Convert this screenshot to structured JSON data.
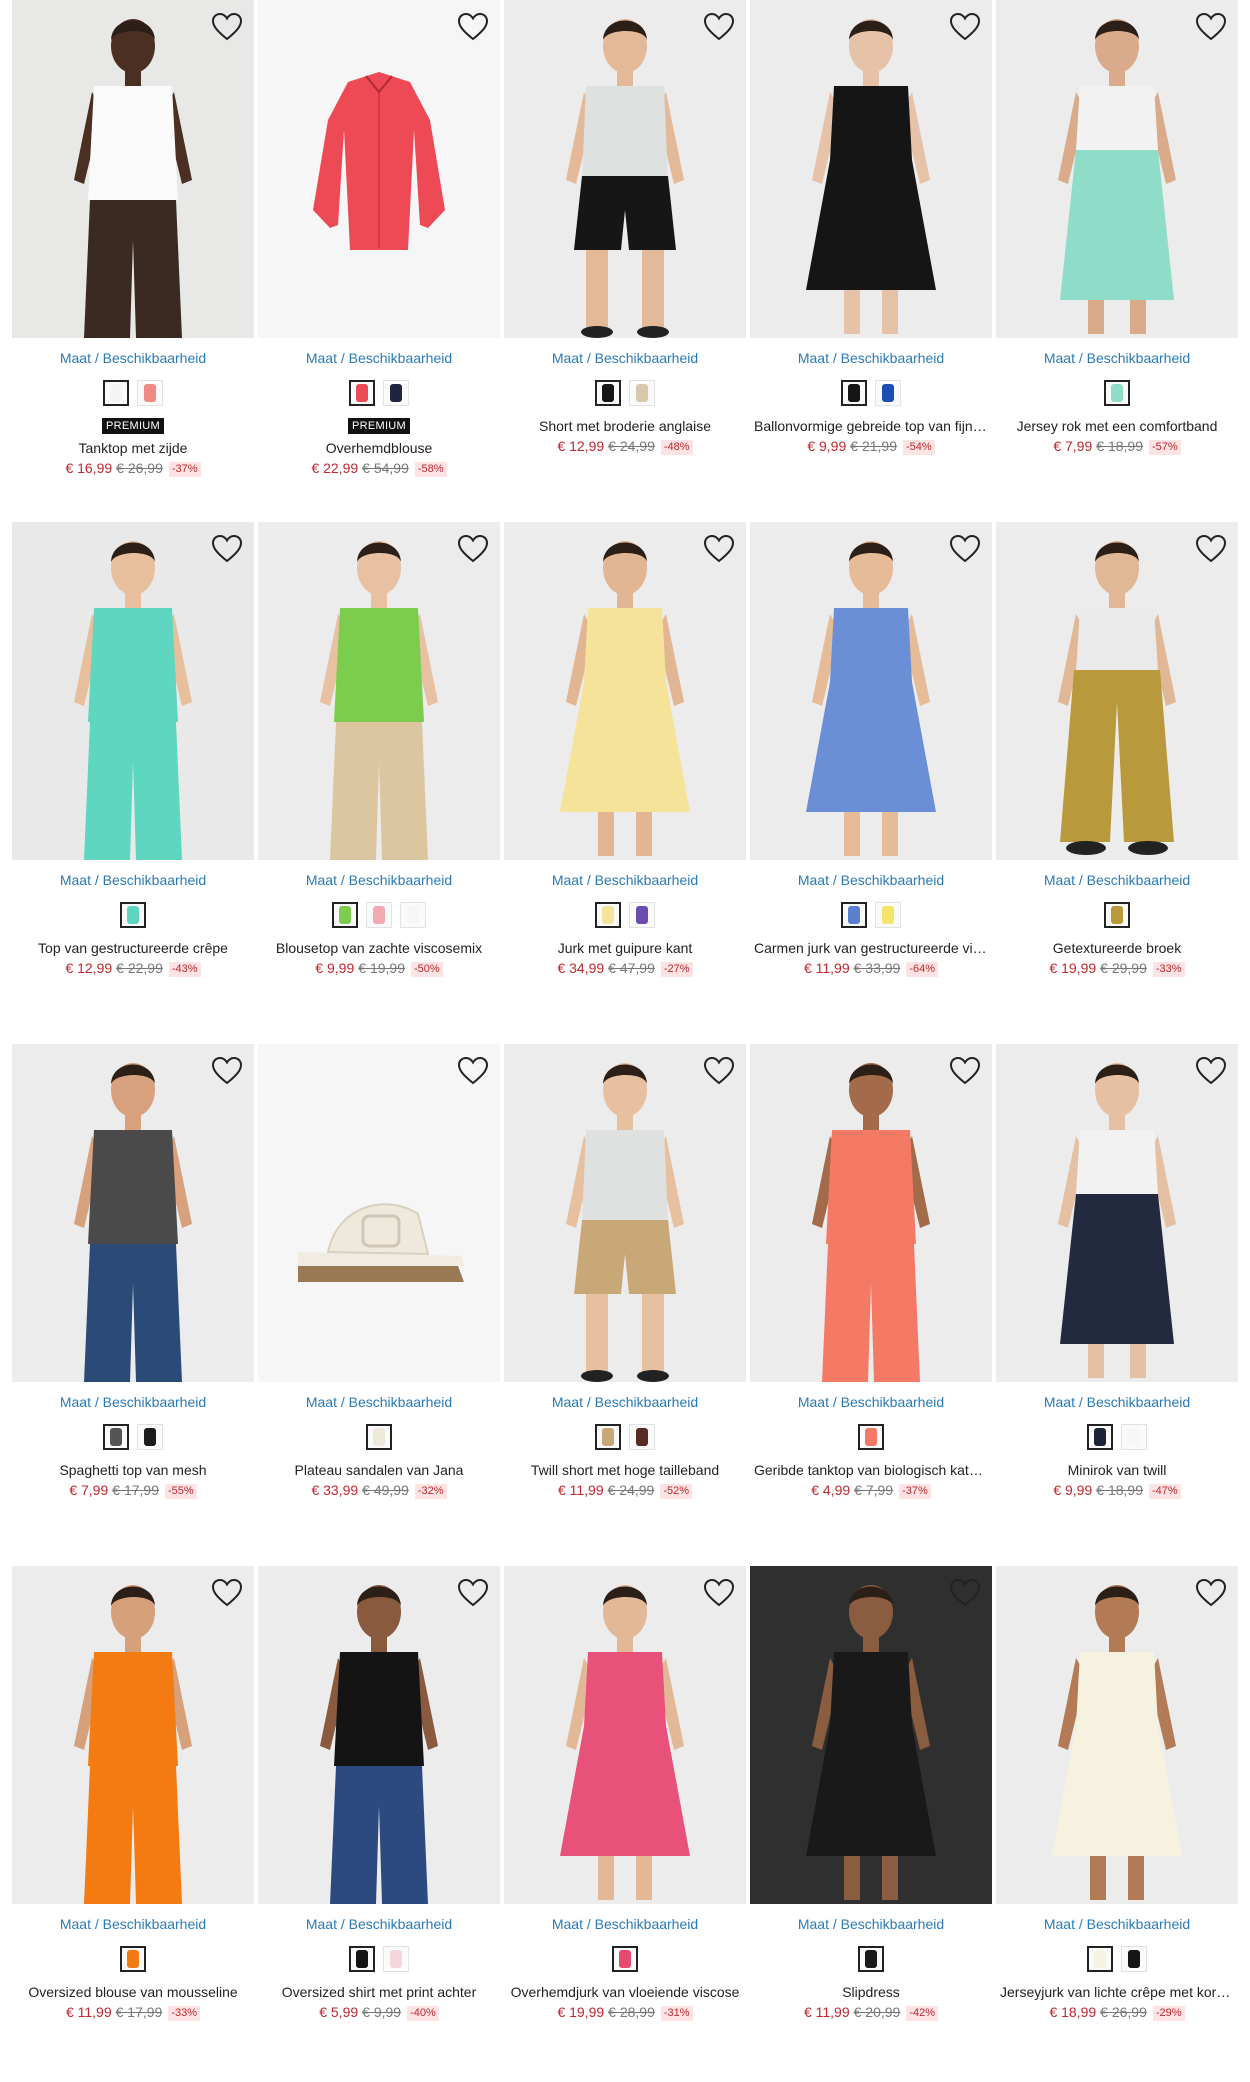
{
  "colors": {
    "link": "#2a7ab8",
    "price": "#c0282d",
    "discount_bg": "#fde3e3",
    "badge_bg": "#111111"
  },
  "products": [
    {
      "name": "Tanktop met zijde",
      "price": "€ 16,99",
      "old_price": "€ 26,99",
      "discount": "-37%",
      "badge": "PREMIUM",
      "size_link": "Maat",
      "avail_link": "Beschikbaarheid",
      "swatches": [
        "#f4f4f2",
        "#f08a86"
      ],
      "selected_swatch": 0,
      "bg": "#e8e8e6",
      "garment": "#fafafa",
      "skin": "#4a2f22",
      "shape": "top",
      "bottom": "#3a2a22"
    },
    {
      "name": "Overhemdblouse",
      "price": "€ 22,99",
      "old_price": "€ 54,99",
      "discount": "-58%",
      "badge": "PREMIUM",
      "size_link": "Maat",
      "avail_link": "Beschikbaarheid",
      "swatches": [
        "#ee4a55",
        "#1d2540"
      ],
      "selected_swatch": 0,
      "bg": "#f6f6f6",
      "garment": "#ee4a55",
      "skin": "",
      "shape": "flat",
      "bottom": ""
    },
    {
      "name": "Short met broderie anglaise",
      "price": "€ 12,99",
      "old_price": "€ 24,99",
      "discount": "-48%",
      "badge": "",
      "size_link": "Maat",
      "avail_link": "Beschikbaarheid",
      "swatches": [
        "#161616",
        "#d8c9ad"
      ],
      "selected_swatch": 0,
      "bg": "#ececec",
      "garment": "#161616",
      "skin": "#e3b998",
      "shape": "shorts",
      "bottom": "#161616"
    },
    {
      "name": "Ballonvormige gebreide top van fijn tricot",
      "price": "€ 9,99",
      "old_price": "€ 21,99",
      "discount": "-54%",
      "badge": "",
      "size_link": "Maat",
      "avail_link": "Beschikbaarheid",
      "swatches": [
        "#151515",
        "#1c4fb5"
      ],
      "selected_swatch": 0,
      "bg": "#ececec",
      "garment": "#151515",
      "skin": "#e6c3a8",
      "shape": "dress",
      "bottom": "#151515"
    },
    {
      "name": "Jersey rok met een comfortband",
      "price": "€ 7,99",
      "old_price": "€ 18,99",
      "discount": "-57%",
      "badge": "",
      "size_link": "Maat",
      "avail_link": "Beschikbaarheid",
      "swatches": [
        "#8fdcc8"
      ],
      "selected_swatch": 0,
      "bg": "#ececec",
      "garment": "#8fdcc8",
      "skin": "#d9ab8b",
      "shape": "skirt",
      "bottom": "#8fdcc8"
    },
    {
      "name": "Top van gestructureerde crêpe",
      "price": "€ 12,99",
      "old_price": "€ 22,99",
      "discount": "-43%",
      "badge": "",
      "size_link": "Maat",
      "avail_link": "Beschikbaarheid",
      "swatches": [
        "#5fd6c0"
      ],
      "selected_swatch": 0,
      "bg": "#e9e9e9",
      "garment": "#5fd6c0",
      "skin": "#e8bf9c",
      "shape": "top",
      "bottom": "#5fd6c0"
    },
    {
      "name": "Blousetop van zachte viscosemix",
      "price": "€ 9,99",
      "old_price": "€ 19,99",
      "discount": "-50%",
      "badge": "",
      "size_link": "Maat",
      "avail_link": "Beschikbaarheid",
      "swatches": [
        "#7ccd4e",
        "#f2a9b0",
        "#f6f6f6"
      ],
      "selected_swatch": 0,
      "bg": "#ececec",
      "garment": "#7ccd4e",
      "skin": "#e7c1a2",
      "shape": "top",
      "bottom": "#dcc6a0"
    },
    {
      "name": "Jurk met guipure kant",
      "price": "€ 34,99",
      "old_price": "€ 47,99",
      "discount": "-27%",
      "badge": "",
      "size_link": "Maat",
      "avail_link": "Beschikbaarheid",
      "swatches": [
        "#f5e39a",
        "#6a4bb0"
      ],
      "selected_swatch": 0,
      "bg": "#ececec",
      "garment": "#f5e39a",
      "skin": "#e2b593",
      "shape": "dress",
      "bottom": "#f5e39a"
    },
    {
      "name": "Carmen jurk van gestructureerde viscose",
      "price": "€ 11,99",
      "old_price": "€ 33,99",
      "discount": "-64%",
      "badge": "",
      "size_link": "Maat",
      "avail_link": "Beschikbaarheid",
      "swatches": [
        "#5a7fcf",
        "#f3e56a"
      ],
      "selected_swatch": 0,
      "bg": "#ececec",
      "garment": "#6b8fd6",
      "skin": "#e5bb98",
      "shape": "dress",
      "bottom": "#6b8fd6"
    },
    {
      "name": "Getextureerde broek",
      "price": "€ 19,99",
      "old_price": "€ 29,99",
      "discount": "-33%",
      "badge": "",
      "size_link": "Maat",
      "avail_link": "Beschikbaarheid",
      "swatches": [
        "#b89a3c"
      ],
      "selected_swatch": 0,
      "bg": "#ececec",
      "garment": "#b89a3c",
      "skin": "#e0b896",
      "shape": "pants",
      "bottom": "#b89a3c"
    },
    {
      "name": "Spaghetti top van mesh",
      "price": "€ 7,99",
      "old_price": "€ 17,99",
      "discount": "-55%",
      "badge": "",
      "size_link": "Maat",
      "avail_link": "Beschikbaarheid",
      "swatches": [
        "#555555",
        "#1a1a1a"
      ],
      "selected_swatch": 0,
      "bg": "#ececec",
      "garment": "#4a4a4a",
      "skin": "#d6a17c",
      "shape": "top",
      "bottom": "#2c4a78"
    },
    {
      "name": "Plateau sandalen van Jana",
      "price": "€ 33,99",
      "old_price": "€ 49,99",
      "discount": "-32%",
      "badge": "",
      "size_link": "Maat",
      "avail_link": "Beschikbaarheid",
      "swatches": [
        "#efe9dc"
      ],
      "selected_swatch": 0,
      "bg": "#f6f6f6",
      "garment": "#efe9dc",
      "skin": "",
      "shape": "shoe",
      "bottom": ""
    },
    {
      "name": "Twill short met hoge tailleband",
      "price": "€ 11,99",
      "old_price": "€ 24,99",
      "discount": "-52%",
      "badge": "",
      "size_link": "Maat",
      "avail_link": "Beschikbaarheid",
      "swatches": [
        "#c9a878",
        "#5a2a24"
      ],
      "selected_swatch": 0,
      "bg": "#ececec",
      "garment": "#c9a878",
      "skin": "#e7c0a0",
      "shape": "shorts",
      "bottom": "#c9a878"
    },
    {
      "name": "Geribde tanktop van biologisch katoen",
      "price": "€ 4,99",
      "old_price": "€ 7,99",
      "discount": "-37%",
      "badge": "",
      "size_link": "Maat",
      "avail_link": "Beschikbaarheid",
      "swatches": [
        "#f57a65"
      ],
      "selected_swatch": 0,
      "bg": "#ececec",
      "garment": "#f57a65",
      "skin": "#a46b4a",
      "shape": "top",
      "bottom": "#f57a65"
    },
    {
      "name": "Minirok van twill",
      "price": "€ 9,99",
      "old_price": "€ 18,99",
      "discount": "-47%",
      "badge": "",
      "size_link": "Maat",
      "avail_link": "Beschikbaarheid",
      "swatches": [
        "#1e2438",
        "#f7f7f7"
      ],
      "selected_swatch": 0,
      "bg": "#ececec",
      "garment": "#232a40",
      "skin": "#e5c0a2",
      "shape": "skirt",
      "bottom": "#232a40"
    },
    {
      "name": "Oversized blouse van mousseline",
      "price": "€ 11,99",
      "old_price": "€ 17,99",
      "discount": "-33%",
      "badge": "",
      "size_link": "Maat",
      "avail_link": "Beschikbaarheid",
      "swatches": [
        "#f47a12"
      ],
      "selected_swatch": 0,
      "bg": "#ececec",
      "garment": "#f47a12",
      "skin": "#d5a07a",
      "shape": "top",
      "bottom": "#f47a12"
    },
    {
      "name": "Oversized shirt met print achter",
      "price": "€ 5,99",
      "old_price": "€ 9,99",
      "discount": "-40%",
      "badge": "",
      "size_link": "Maat",
      "avail_link": "Beschikbaarheid",
      "swatches": [
        "#141414",
        "#f4d6dc"
      ],
      "selected_swatch": 0,
      "bg": "#ececec",
      "garment": "#141414",
      "skin": "#8a5a3e",
      "shape": "top",
      "bottom": "#2d4a80"
    },
    {
      "name": "Overhemdjurk van vloeiende viscose",
      "price": "€ 19,99",
      "old_price": "€ 28,99",
      "discount": "-31%",
      "badge": "",
      "size_link": "Maat",
      "avail_link": "Beschikbaarheid",
      "swatches": [
        "#e84a6e"
      ],
      "selected_swatch": 0,
      "bg": "#ececec",
      "garment": "#e8517a",
      "skin": "#e2b896",
      "shape": "dress",
      "bottom": "#e8517a"
    },
    {
      "name": "Slipdress",
      "price": "€ 11,99",
      "old_price": "€ 20,99",
      "discount": "-42%",
      "badge": "",
      "size_link": "Maat",
      "avail_link": "Beschikbaarheid",
      "swatches": [
        "#1a1a1a"
      ],
      "selected_swatch": 0,
      "bg": "#2f2f2f",
      "garment": "#191919",
      "skin": "#8a5c40",
      "shape": "dress",
      "bottom": "#191919"
    },
    {
      "name": "Jerseyjurk van lichte crêpe met korte mouwen",
      "price": "€ 18,99",
      "old_price": "€ 26,99",
      "discount": "-29%",
      "badge": "",
      "size_link": "Maat",
      "avail_link": "Beschikbaarheid",
      "swatches": [
        "#f7f1df",
        "#151515"
      ],
      "selected_swatch": 0,
      "bg": "#ececec",
      "garment": "#f7f1df",
      "skin": "#b27a55",
      "shape": "dress",
      "bottom": "#f7f1df"
    }
  ]
}
